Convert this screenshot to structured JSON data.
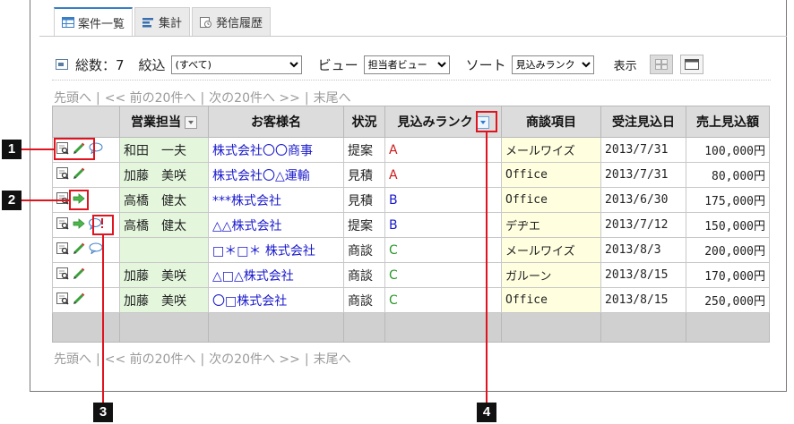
{
  "tabs": [
    {
      "label": "案件一覧",
      "icon": "table-icon",
      "active": true
    },
    {
      "label": "集計",
      "icon": "bar-chart-icon",
      "active": false
    },
    {
      "label": "発信履歴",
      "icon": "history-icon",
      "active": false
    }
  ],
  "filter": {
    "total_label": "総数：7",
    "filter_label": "絞込",
    "filter_value": "(すべて)",
    "view_label": "ビュー",
    "view_value": "担当者ビュー",
    "sort_label": "ソート",
    "sort_value": "見込みランク",
    "display_label": "表示"
  },
  "pager": {
    "first": "先頭へ",
    "prev": "<< 前の20件へ",
    "next": "次の20件へ >>",
    "last": "末尾へ"
  },
  "table": {
    "headers": [
      "",
      "営業担当",
      "お客様名",
      "状況",
      "見込みランク",
      "商談項目",
      "受注見込日",
      "売上見込額"
    ],
    "rows": [
      {
        "icons": [
          "detail-icon",
          "edit-icon",
          "comment-icon"
        ],
        "rep": "和田　一夫",
        "customer": "株式会社〇〇商事",
        "status": "提案",
        "rank": "A",
        "item": "メールワイズ",
        "date": "2013/7/31",
        "amount": "100,000円"
      },
      {
        "icons": [
          "detail-icon",
          "edit-icon"
        ],
        "rep": "加藤　美咲",
        "customer": "株式会社〇△運輸",
        "status": "見積",
        "rank": "A",
        "item": "Office",
        "date": "2013/7/31",
        "amount": "80,000円"
      },
      {
        "icons": [
          "detail-icon",
          "proceed-arrow-icon"
        ],
        "rep": "高橋　健太",
        "customer": "***株式会社",
        "status": "見積",
        "rank": "B",
        "item": " Office",
        "date": "2013/6/30",
        "amount": "175,000円"
      },
      {
        "icons": [
          "detail-icon",
          "proceed-arrow-icon",
          "comment-alert-icon"
        ],
        "rep": "高橋　健太",
        "customer": "△△株式会社",
        "status": "提案",
        "rank": "B",
        "item": "デヂエ",
        "date": "2013/7/12",
        "amount": "150,000円"
      },
      {
        "icons": [
          "detail-icon",
          "edit-icon",
          "comment-icon"
        ],
        "rep": "",
        "customer": "□＊□＊ 株式会社",
        "status": "商談",
        "rank": "C",
        "item": "メールワイズ",
        "date": "2013/8/3",
        "amount": "200,000円"
      },
      {
        "icons": [
          "detail-icon",
          "edit-icon"
        ],
        "rep": "加藤　美咲",
        "customer": "△□△株式会社",
        "status": "商談",
        "rank": "C",
        "item": "ガルーン",
        "date": "2013/8/15",
        "amount": "170,000円"
      },
      {
        "icons": [
          "detail-icon",
          "edit-icon"
        ],
        "rep": "加藤　美咲",
        "customer": "〇□株式会社",
        "status": "商談",
        "rank": "C",
        "item": "Office",
        "date": "2013/8/15",
        "amount": "250,000円"
      }
    ]
  },
  "markers": [
    "1",
    "2",
    "3",
    "4"
  ],
  "colors": {
    "accent": "#e0141e",
    "link": "#1a1acc",
    "rank_A": "#cc1a1a",
    "rank_C": "#2a9a2a",
    "rep_bg": "#e4f7dd",
    "item_bg": "#ffffe0"
  }
}
